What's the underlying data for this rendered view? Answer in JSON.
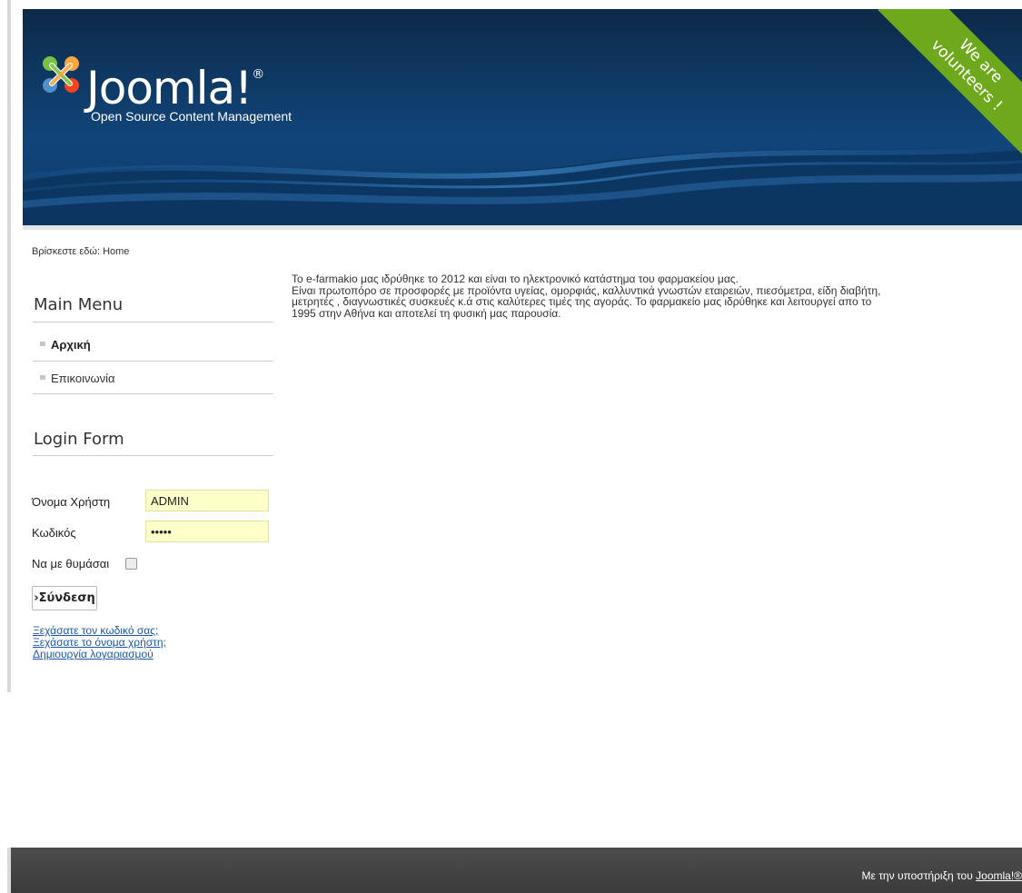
{
  "header": {
    "brand": "Joomla!",
    "trademark": "®",
    "tagline": "Open Source Content Management",
    "ribbon_lines": [
      "We are",
      "volunteers !"
    ],
    "colors": {
      "ribbon": "#6ea91d",
      "background": "#0f3a66"
    }
  },
  "breadcrumb": {
    "prefix": "Βρίσκεστε εδώ:",
    "current": "Home"
  },
  "main_menu": {
    "title": "Main Menu",
    "items": [
      {
        "label": "Αρχική",
        "active": true
      },
      {
        "label": "Επικοινωνία",
        "active": false
      }
    ]
  },
  "login_form": {
    "title": "Login Form",
    "username_label": "Όνομα Χρήστη",
    "username_value": "ADMIN",
    "password_label": "Κωδικός",
    "password_value": "•••••",
    "remember_label": "Να με θυμάσαι",
    "remember_checked": false,
    "submit_label": "›Σύνδεση",
    "links": [
      "Ξεχάσατε τον κωδικό σας;",
      "Ξεχάσατε το όνομα χρήστη;",
      "Δημιουργία λογαριασμού"
    ]
  },
  "content": {
    "lines": [
      "Το e-farmakio μας ιδρύθηκε το 2012 και είναι το ηλεκτρονικό κατάστημα του φαρμακείου μας.",
      "Είναι πρωτοπόρο σε προσφορές με προϊόντα υγείας, ομορφιάς, καλλυντικά γνωστών εταιρειών, πιεσόμετρα, είδη διαβήτη,",
      "μετρητές , διαγνωστικές συσκευές κ.ά στις καλύτερες τιμές της αγοράς. Το φαρμακείο μας ιδρύθηκε και λειτουργεί απο το",
      "1995 στην Αθήνα και αποτελεί τη φυσική μας παρουσία."
    ]
  },
  "footer": {
    "text": "Με την υποστήριξη του",
    "link_label": "Joomla!®"
  }
}
